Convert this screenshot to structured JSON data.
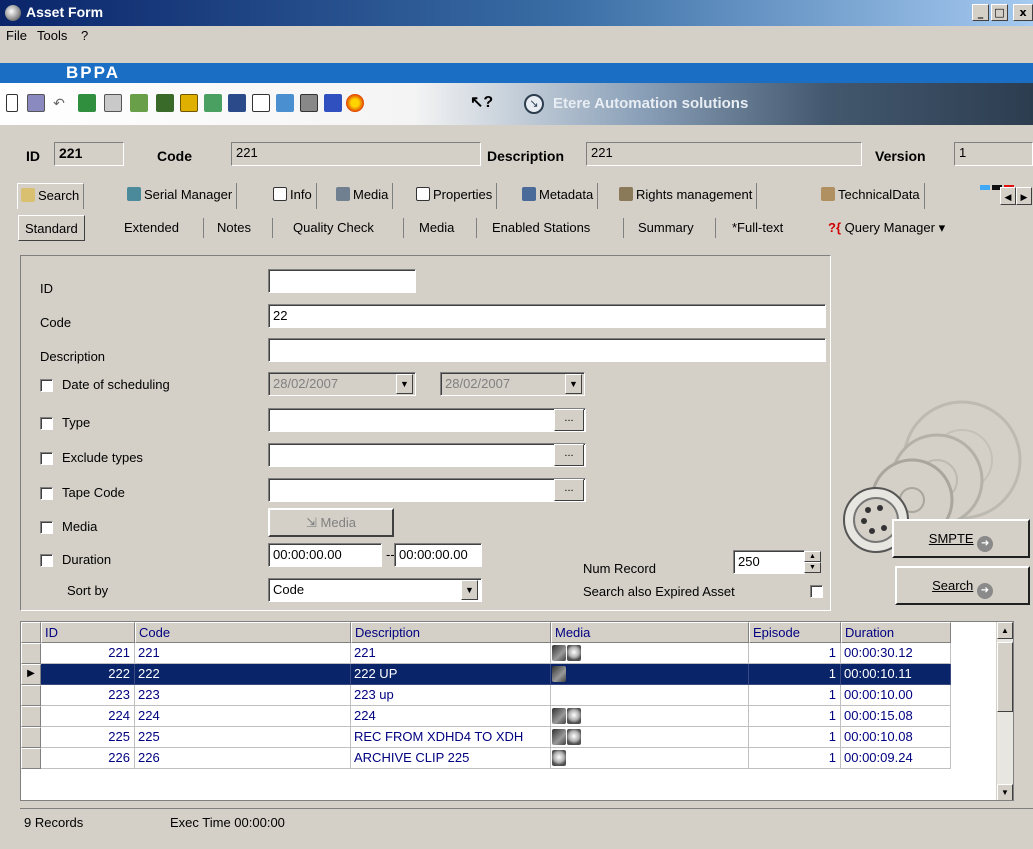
{
  "window": {
    "title": "Asset Form",
    "min": "_",
    "max": "□",
    "close": "x"
  },
  "menu": [
    "File",
    "Tools",
    "?"
  ],
  "banner": {
    "brand": "BPPA"
  },
  "toolbar": {
    "help": "?",
    "tagline": "Etere Automation solutions",
    "brand_colors": [
      "#3fa9f5",
      "#101010",
      "#e01010"
    ]
  },
  "header": {
    "id_label": "ID",
    "id_value": "221",
    "code_label": "Code",
    "code_value": "221",
    "description_label": "Description",
    "description_value": "221",
    "version_label": "Version",
    "version_value": "1"
  },
  "tabs": [
    "Search",
    "Serial Manager",
    "Info",
    "Media",
    "Properties",
    "Metadata",
    "Rights management",
    "TechnicalData"
  ],
  "subtabs": [
    "Standard",
    "Extended",
    "Notes",
    "Quality Check",
    "Media",
    "Enabled Stations",
    "Summary",
    "*Full-text"
  ],
  "query_manager": "Query Manager",
  "form": {
    "id_label": "ID",
    "id_value": "",
    "code_label": "Code",
    "code_value": "22",
    "description_label": "Description",
    "description_value": "",
    "date_label": "Date of scheduling",
    "date_from": "28/02/2007",
    "date_to": "28/02/2007",
    "type_label": "Type",
    "exclude_label": "Exclude types",
    "tape_label": "Tape Code",
    "media_label": "Media",
    "media_button": "Media",
    "duration_label": "Duration",
    "duration_from": "00:00:00.00",
    "duration_sep": "--",
    "duration_to": "00:00:00.00",
    "sort_label": "Sort by",
    "sort_value": "Code",
    "num_record_label": "Num Record",
    "num_record_value": "250",
    "expired_label": "Search also Expired Asset",
    "ellipsis": "..."
  },
  "buttons": {
    "smpte": "SMPTE",
    "search": "Search"
  },
  "grid": {
    "columns": [
      "ID",
      "Code",
      "Description",
      "Media",
      "Episode",
      "Duration"
    ],
    "rows": [
      {
        "id": "221",
        "code": "221",
        "description": "221",
        "media": [
          "video",
          "hd"
        ],
        "episode": "1",
        "duration": "00:00:30.12",
        "selected": false
      },
      {
        "id": "222",
        "code": "222",
        "description": "222 UP",
        "media": [
          "video"
        ],
        "episode": "1",
        "duration": "00:00:10.11",
        "selected": true
      },
      {
        "id": "223",
        "code": "223",
        "description": "223 up",
        "media": [],
        "episode": "1",
        "duration": "00:00:10.00",
        "selected": false
      },
      {
        "id": "224",
        "code": "224",
        "description": "224",
        "media": [
          "video",
          "hd"
        ],
        "episode": "1",
        "duration": "00:00:15.08",
        "selected": false
      },
      {
        "id": "225",
        "code": "225",
        "description": "REC FROM XDHD4 TO XDH",
        "media": [
          "video",
          "hd"
        ],
        "episode": "1",
        "duration": "00:00:10.08",
        "selected": false
      },
      {
        "id": "226",
        "code": "226",
        "description": "ARCHIVE CLIP 225",
        "media": [
          "hd"
        ],
        "episode": "1",
        "duration": "00:00:09.24",
        "selected": false
      }
    ]
  },
  "status": {
    "records": "9 Records",
    "exec": "Exec Time 00:00:00"
  }
}
